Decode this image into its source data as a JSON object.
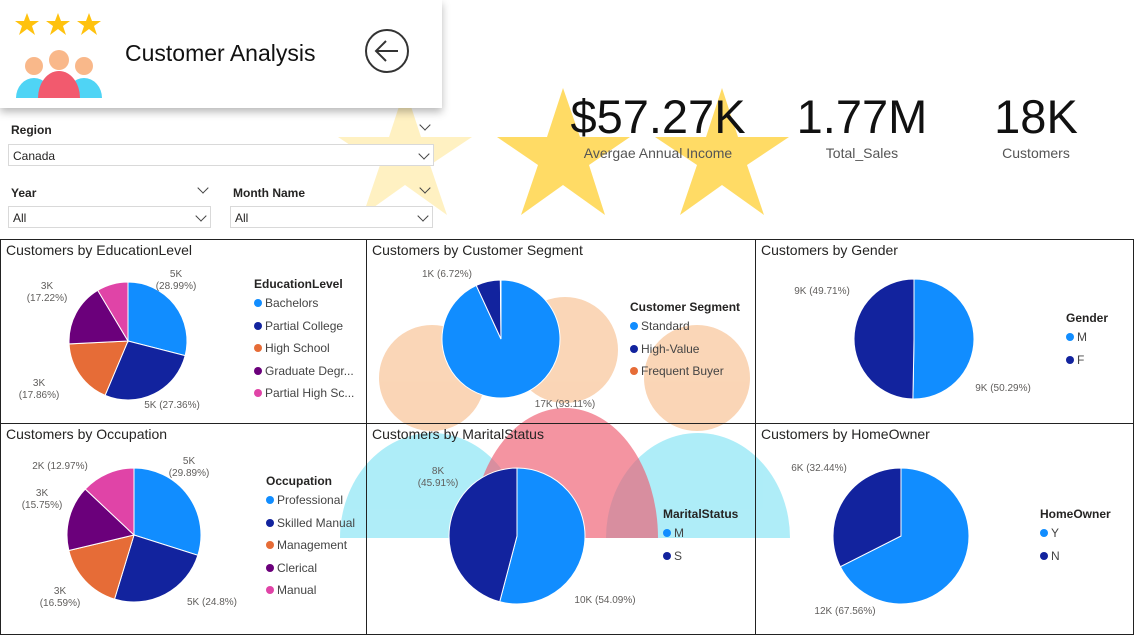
{
  "header": {
    "title": "Customer Analysis",
    "rating_stars": 3
  },
  "kpis": [
    {
      "value": "$57.27K",
      "label": "Avergae Annual Income"
    },
    {
      "value": "1.77M",
      "label": "Total_Sales"
    },
    {
      "value": "18K",
      "label": "Customers"
    }
  ],
  "filters": {
    "region": {
      "label": "Region",
      "value": "Canada"
    },
    "year": {
      "label": "Year",
      "value": "All"
    },
    "month": {
      "label": "Month Name",
      "value": "All"
    }
  },
  "colors": {
    "bright_blue": "#118DFF",
    "dark_blue": "#12239E",
    "orange": "#E66C37",
    "purple": "#6B007B",
    "magenta": "#E044A7",
    "star_yellow": "#FFCC00"
  },
  "icons": [
    "star-icon",
    "people-group-icon",
    "back-arrow-icon",
    "chevron-down-icon"
  ],
  "chart_data": [
    {
      "type": "pie",
      "title": "Customers by EducationLevel",
      "legend_title": "EducationLevel",
      "categories": [
        "Bachelors",
        "Partial College",
        "High School",
        "Graduate Degr...",
        "Partial High Sc..."
      ],
      "values": [
        28.99,
        27.36,
        17.86,
        17.22,
        8.57
      ],
      "labels": [
        "5K\n(28.99%)",
        "5K (27.36%)",
        "3K\n(17.86%)",
        "3K\n(17.22%)",
        ""
      ],
      "colors": [
        "#118DFF",
        "#12239E",
        "#E66C37",
        "#6B007B",
        "#E044A7"
      ]
    },
    {
      "type": "pie",
      "title": "Customers by Customer Segment",
      "legend_title": "Customer Segment",
      "categories": [
        "Standard",
        "High-Value",
        "Frequent Buyer"
      ],
      "values": [
        93.11,
        6.72,
        0.17
      ],
      "labels": [
        "17K (93.11%)",
        "1K (6.72%)",
        ""
      ],
      "colors": [
        "#118DFF",
        "#12239E",
        "#E66C37"
      ]
    },
    {
      "type": "pie",
      "title": "Customers by Gender",
      "legend_title": "Gender",
      "categories": [
        "M",
        "F"
      ],
      "values": [
        50.29,
        49.71
      ],
      "labels": [
        "9K (50.29%)",
        "9K (49.71%)"
      ],
      "colors": [
        "#118DFF",
        "#12239E"
      ]
    },
    {
      "type": "pie",
      "title": "Customers by Occupation",
      "legend_title": "Occupation",
      "categories": [
        "Professional",
        "Skilled Manual",
        "Management",
        "Clerical",
        "Manual"
      ],
      "values": [
        29.89,
        24.8,
        16.59,
        15.75,
        12.97
      ],
      "labels": [
        "5K\n(29.89%)",
        "5K (24.8%)",
        "3K\n(16.59%)",
        "3K\n(15.75%)",
        "2K (12.97%)"
      ],
      "colors": [
        "#118DFF",
        "#12239E",
        "#E66C37",
        "#6B007B",
        "#E044A7"
      ]
    },
    {
      "type": "pie",
      "title": "Customers by MaritalStatus",
      "legend_title": "MaritalStatus",
      "categories": [
        "M",
        "S"
      ],
      "values": [
        54.09,
        45.91
      ],
      "labels": [
        "10K (54.09%)",
        "8K\n(45.91%)"
      ],
      "colors": [
        "#118DFF",
        "#12239E"
      ]
    },
    {
      "type": "pie",
      "title": "Customers by HomeOwner",
      "legend_title": "HomeOwner",
      "categories": [
        "Y",
        "N"
      ],
      "values": [
        67.56,
        32.44
      ],
      "labels": [
        "12K (67.56%)",
        "6K (32.44%)"
      ],
      "colors": [
        "#118DFF",
        "#12239E"
      ]
    }
  ]
}
